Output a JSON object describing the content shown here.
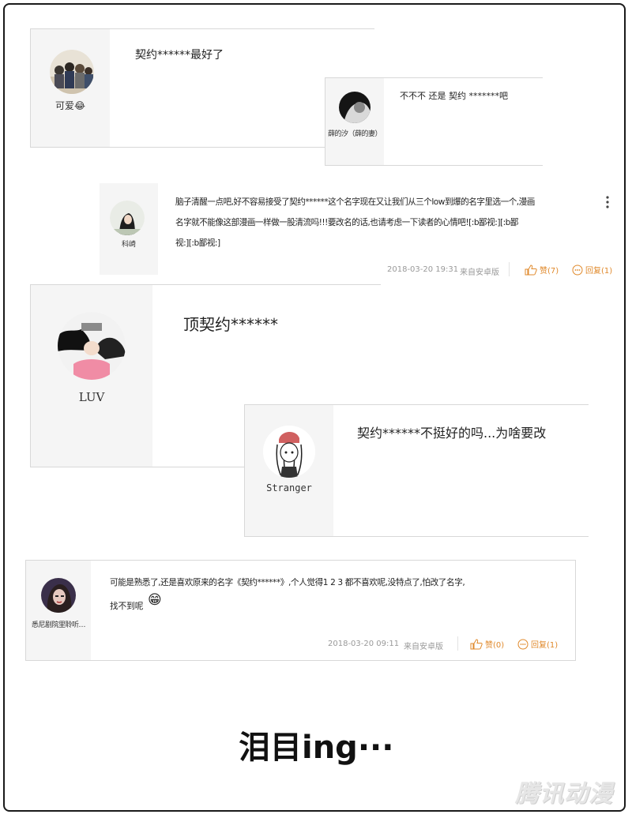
{
  "comments": [
    {
      "username": "可爱😂",
      "text": "契约******最好了"
    },
    {
      "username": "薛的汐（薛的妻）",
      "text": "不不不 还是 契约 *******吧"
    },
    {
      "username": "科崎",
      "text_lines": [
        "脑子清醒一点吧,好不容易接受了契约******这个名字现在又让我们从三个low到爆的名字里选一个,漫画",
        "名字就不能像这部漫画一样做一股清流吗!!!要改名的话,也请考虑一下读者的心情吧![:b鄙视:][:b鄙",
        "视:][:b鄙视:]"
      ],
      "time": "2018-03-20 19:31",
      "source": "来自安卓版",
      "like_label": "赞(7)",
      "reply_label": "回复(1)"
    },
    {
      "username": "LUV",
      "text": "顶契约******"
    },
    {
      "username": "Stranger",
      "text": "契约******不挺好的吗...为啥要改"
    },
    {
      "username": "悉尼剧院里聆听…",
      "text_lines": [
        "可能是熟悉了,还是喜欢原来的名字《契约******》,个人觉得1 2 3 都不喜欢呢,没特点了,怕改了名字,",
        "找不到呢"
      ],
      "emoji": "😁",
      "time": "2018-03-20 09:11",
      "source": "来自安卓版",
      "like_label": "赞(0)",
      "reply_label": "回复(1)"
    }
  ],
  "caption": "泪目ing···",
  "watermark": "腾讯动漫",
  "colors": {
    "accent": "#e0892b",
    "meta": "#999999",
    "panel": "#f5f5f5",
    "border": "#d8d8d8"
  },
  "icons": [
    "more-vertical-icon",
    "thumbs-up-icon",
    "reply-bubble-icon",
    "grin-emoji-icon"
  ]
}
